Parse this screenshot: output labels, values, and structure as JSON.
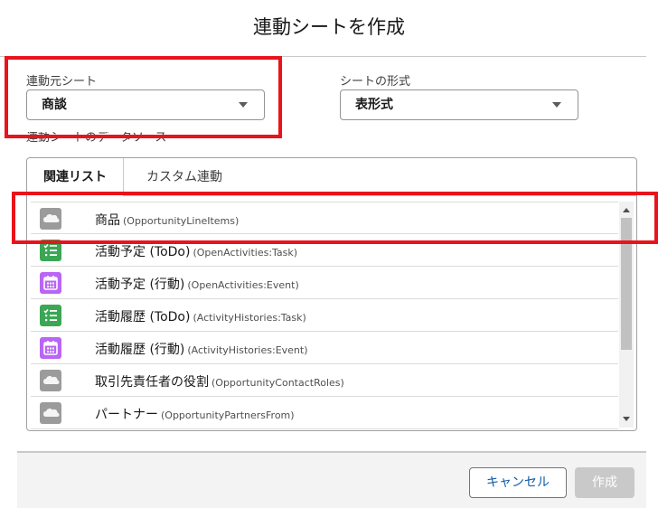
{
  "dialog": {
    "title": "連動シートを作成"
  },
  "source_sheet": {
    "label": "連動元シート",
    "value": "商談"
  },
  "sheet_format": {
    "label": "シートの形式",
    "value": "表形式"
  },
  "datasource_label": "連動シートのデータソース",
  "tabs": [
    {
      "label": "関連リスト",
      "active": true
    },
    {
      "label": "カスタム連動",
      "active": false
    }
  ],
  "list_items": [
    {
      "name": "商品",
      "api": "(OpportunityLineItems)",
      "icon": "salesforce-cloud-icon",
      "color": "#9b9b9b"
    },
    {
      "name": "活動予定 (ToDo)",
      "api": "(OpenActivities:Task)",
      "icon": "task-checklist-icon",
      "color": "#3ba755"
    },
    {
      "name": "活動予定 (行動)",
      "api": "(OpenActivities:Event)",
      "icon": "event-calendar-icon",
      "color": "#b965f5"
    },
    {
      "name": "活動履歴 (ToDo)",
      "api": "(ActivityHistories:Task)",
      "icon": "task-checklist-icon",
      "color": "#3ba755"
    },
    {
      "name": "活動履歴 (行動)",
      "api": "(ActivityHistories:Event)",
      "icon": "event-calendar-icon",
      "color": "#b965f5"
    },
    {
      "name": "取引先責任者の役割",
      "api": "(OpportunityContactRoles)",
      "icon": "salesforce-cloud-icon",
      "color": "#9b9b9b"
    },
    {
      "name": "パートナー",
      "api": "(OpportunityPartnersFrom)",
      "icon": "salesforce-cloud-icon",
      "color": "#9b9b9b"
    }
  ],
  "footer": {
    "cancel_label": "キャンセル",
    "create_label": "作成"
  },
  "colors": {
    "highlight": "#e8141c",
    "link": "#0b5cab"
  }
}
